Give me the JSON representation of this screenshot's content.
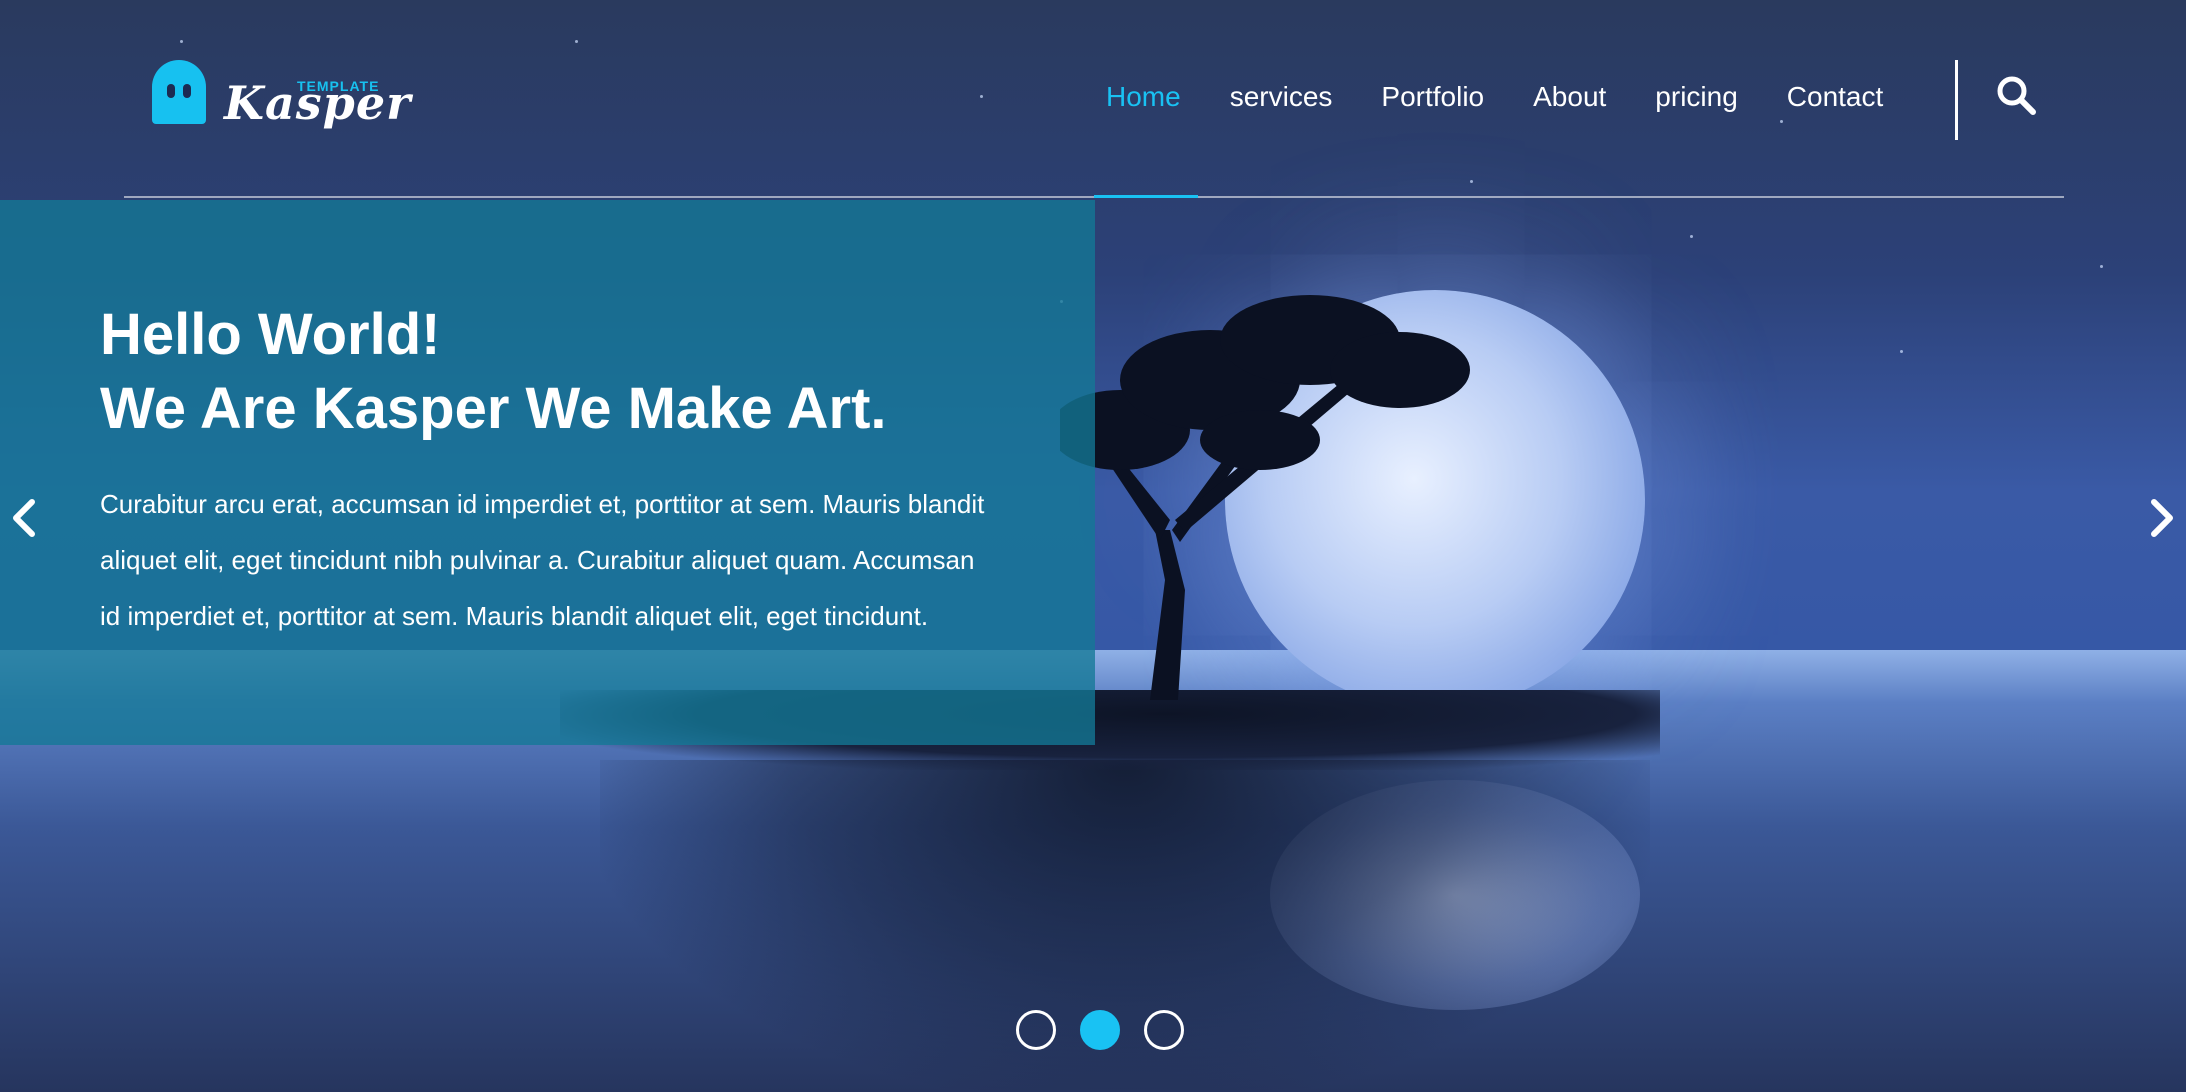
{
  "brand": {
    "logo_word": "Kasper",
    "logo_tag": "TEMPLATE",
    "accent_color": "#19c2f3"
  },
  "nav": {
    "items": [
      {
        "label": "Home",
        "active": true
      },
      {
        "label": "services",
        "active": false
      },
      {
        "label": "Portfolio",
        "active": false
      },
      {
        "label": "About",
        "active": false
      },
      {
        "label": "pricing",
        "active": false
      },
      {
        "label": "Contact",
        "active": false
      }
    ],
    "search_icon": "search-icon"
  },
  "hero": {
    "title_line1": "Hello World!",
    "title_line2": "We Are Kasper We Make Art.",
    "text": "Curabitur arcu erat, accumsan id imperdiet et, porttitor at sem. Mauris blandit aliquet elit, eget tincidunt nibh pulvinar a. Curabitur aliquet quam. Accumsan id imperdiet et, porttitor at sem. Mauris blandit aliquet elit, eget tincidunt.",
    "panel_color": "#1378a0"
  },
  "slider": {
    "prev_icon": "chevron-left-icon",
    "next_icon": "chevron-right-icon",
    "dots": [
      {
        "active": false
      },
      {
        "active": true
      },
      {
        "active": false
      }
    ]
  }
}
